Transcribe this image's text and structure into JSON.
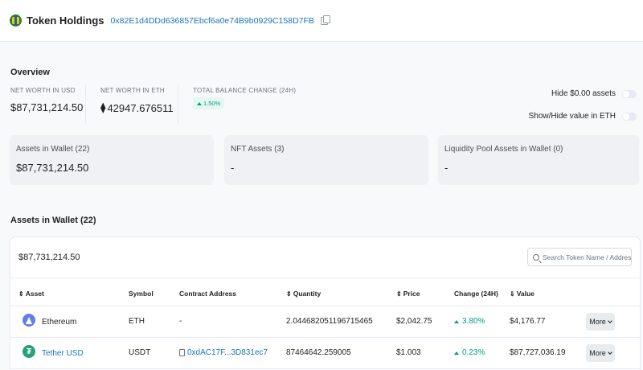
{
  "header": {
    "title": "Token Holdings",
    "address": "0x82E1d4DDd636857Ebcf6a0e74B9b0929C158D7FB"
  },
  "overview": {
    "title": "Overview",
    "net_worth_usd_label": "NET WORTH IN USD",
    "net_worth_usd_value": "$87,731,214.50",
    "net_worth_eth_label": "NET WORTH IN ETH",
    "net_worth_eth_value": "42947.676511",
    "balance_change_label": "TOTAL BALANCE CHANGE (24H)",
    "balance_change_value": "1.50%",
    "hide_zero_label": "Hide $0.00 assets",
    "show_hide_eth_label": "Show/Hide value in ETH"
  },
  "cards": [
    {
      "label": "Assets in Wallet (22)",
      "value": "$87,731,214.50"
    },
    {
      "label": "NFT Assets (3)",
      "value": "-"
    },
    {
      "label": "Liquidity Pool Assets in Wallet (0)",
      "value": "-"
    }
  ],
  "assets": {
    "title": "Assets in Wallet (22)",
    "total": "$87,731,214.50",
    "search_placeholder": "Search Token Name / Address",
    "columns": {
      "asset": "Asset",
      "symbol": "Symbol",
      "contract": "Contract Address",
      "quantity": "Quantity",
      "price": "Price",
      "change": "Change (24H)",
      "value": "Value"
    },
    "more_label": "More",
    "rows": [
      {
        "name": "Ethereum",
        "symbol": "ETH",
        "contract": "-",
        "quantity": "2.044682051196715465",
        "price": "$2,042.75",
        "change": "3.80%",
        "value": "$4,176.77"
      },
      {
        "name": "Tether USD",
        "symbol": "USDT",
        "contract": "0xdAC17F...3D831ec7",
        "quantity": "87464642.259005",
        "price": "$1.003",
        "change": "0.23%",
        "value": "$87,727,036.19"
      }
    ]
  },
  "colors": {
    "link": "#1c75bc",
    "positive": "#00a186",
    "card_bg": "#eff1f4"
  }
}
